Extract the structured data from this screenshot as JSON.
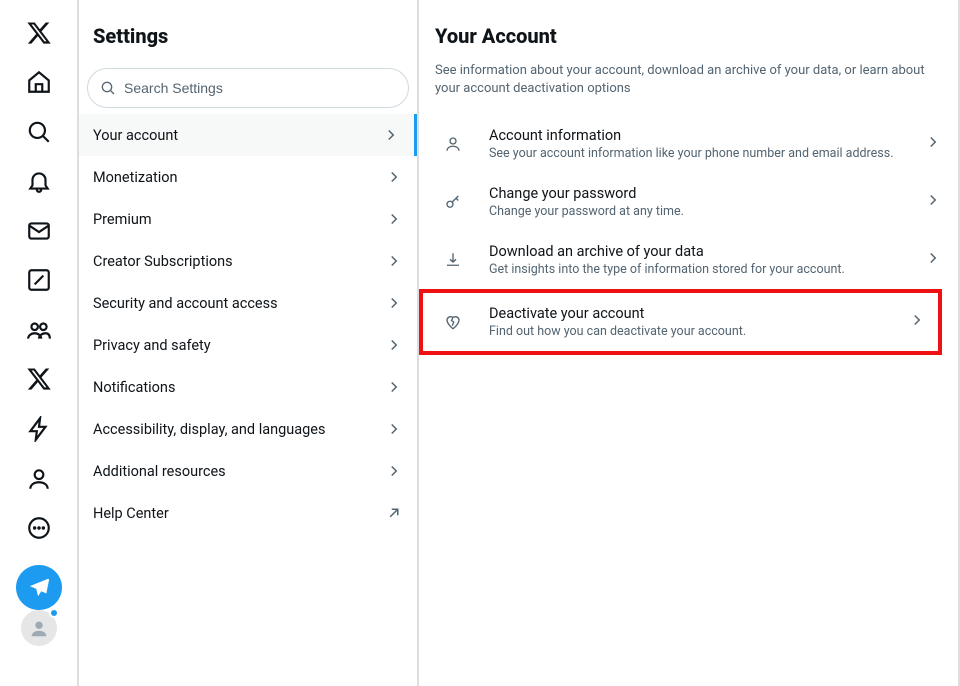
{
  "settings": {
    "title": "Settings",
    "search_placeholder": "Search Settings",
    "items": [
      {
        "label": "Your account",
        "active": true,
        "external": false
      },
      {
        "label": "Monetization",
        "active": false,
        "external": false
      },
      {
        "label": "Premium",
        "active": false,
        "external": false
      },
      {
        "label": "Creator Subscriptions",
        "active": false,
        "external": false
      },
      {
        "label": "Security and account access",
        "active": false,
        "external": false
      },
      {
        "label": "Privacy and safety",
        "active": false,
        "external": false
      },
      {
        "label": "Notifications",
        "active": false,
        "external": false
      },
      {
        "label": "Accessibility, display, and languages",
        "active": false,
        "external": false
      },
      {
        "label": "Additional resources",
        "active": false,
        "external": false
      },
      {
        "label": "Help Center",
        "active": false,
        "external": true
      }
    ]
  },
  "detail": {
    "title": "Your Account",
    "description": "See information about your account, download an archive of your data, or learn about your account deactivation options",
    "options": [
      {
        "title": "Account information",
        "sub": "See your account information like your phone number and email address.",
        "icon": "person-icon",
        "highlight": false
      },
      {
        "title": "Change your password",
        "sub": "Change your password at any time.",
        "icon": "key-icon",
        "highlight": false
      },
      {
        "title": "Download an archive of your data",
        "sub": "Get insights into the type of information stored for your account.",
        "icon": "download-icon",
        "highlight": false
      },
      {
        "title": "Deactivate your account",
        "sub": "Find out how you can deactivate your account.",
        "icon": "heartbreak-icon",
        "highlight": true
      }
    ]
  }
}
